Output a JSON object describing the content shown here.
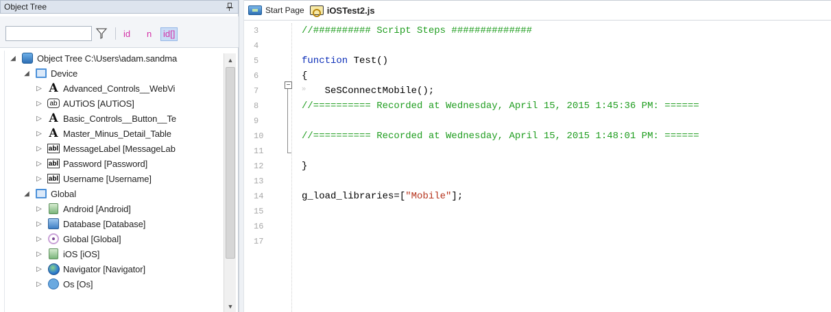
{
  "object_tree": {
    "title": "Object Tree",
    "filter": {
      "value": "",
      "placeholder": ""
    },
    "modes": {
      "id": "id",
      "n": "n",
      "idx_open": "id[",
      "idx_close": "]"
    },
    "nodes": [
      {
        "label": "Object Tree C:\\Users\\adam.sandma",
        "icon": "database-tree-icon",
        "expanded": true
      },
      {
        "label": "Device",
        "icon": "device-box-icon",
        "expanded": true
      },
      {
        "label": "Advanced_Controls__WebVi",
        "icon": "text-control-icon",
        "expanded": false
      },
      {
        "label": "AUTiOS [AUTiOS]",
        "icon": "ab-control-icon",
        "expanded": false
      },
      {
        "label": "Basic_Controls__Button__Te",
        "icon": "text-control-icon",
        "expanded": false
      },
      {
        "label": "Master_Minus_Detail_Table",
        "icon": "text-control-icon",
        "expanded": false
      },
      {
        "label": "MessageLabel [MessageLab",
        "icon": "label-control-icon",
        "expanded": false
      },
      {
        "label": "Password [Password]",
        "icon": "label-control-icon",
        "expanded": false
      },
      {
        "label": "Username [Username]",
        "icon": "label-control-icon",
        "expanded": false
      },
      {
        "label": "Global",
        "icon": "global-box-icon",
        "expanded": true
      },
      {
        "label": "Android [Android]",
        "icon": "android-icon",
        "expanded": false
      },
      {
        "label": "Database [Database]",
        "icon": "database-icon",
        "expanded": false
      },
      {
        "label": "Global [Global]",
        "icon": "global-icon",
        "expanded": false
      },
      {
        "label": "iOS [iOS]",
        "icon": "ios-icon",
        "expanded": false
      },
      {
        "label": "Navigator [Navigator]",
        "icon": "navigator-icon",
        "expanded": false
      },
      {
        "label": "Os [Os]",
        "icon": "os-icon",
        "expanded": false
      }
    ]
  },
  "editor": {
    "tabs": [
      {
        "label": "Start Page",
        "icon": "start-page-icon",
        "active": false
      },
      {
        "label": "iOSTest2.js",
        "icon": "script-file-icon",
        "active": true
      }
    ],
    "lines": [
      {
        "number": "3",
        "parts": [
          {
            "t": "//########## Script Steps ##############",
            "k": "comment"
          }
        ]
      },
      {
        "number": "4",
        "parts": []
      },
      {
        "number": "5",
        "parts": [
          {
            "t": "function",
            "k": "keyword"
          },
          {
            "t": " Test()",
            "k": "def"
          }
        ]
      },
      {
        "number": "6",
        "parts": [
          {
            "t": "{",
            "k": "op"
          }
        ]
      },
      {
        "number": "7",
        "parts": [
          {
            "t": "    SeSConnectMobile();",
            "k": "def"
          }
        ]
      },
      {
        "number": "8",
        "parts": [
          {
            "t": "//========== Recorded at Wednesday, April 15, 2015 1:45:36 PM: ======",
            "k": "comment"
          }
        ]
      },
      {
        "number": "9",
        "parts": []
      },
      {
        "number": "10",
        "parts": [
          {
            "t": "//========== Recorded at Wednesday, April 15, 2015 1:48:01 PM: ======",
            "k": "comment"
          }
        ]
      },
      {
        "number": "11",
        "parts": []
      },
      {
        "number": "12",
        "parts": [
          {
            "t": "}",
            "k": "op"
          }
        ]
      },
      {
        "number": "13",
        "parts": []
      },
      {
        "number": "14",
        "parts": [
          {
            "t": "g_load_libraries=[",
            "k": "def"
          },
          {
            "t": "\"Mobile\"",
            "k": "string"
          },
          {
            "t": "];",
            "k": "op"
          }
        ]
      },
      {
        "number": "15",
        "parts": []
      },
      {
        "number": "16",
        "parts": []
      },
      {
        "number": "17",
        "parts": []
      }
    ],
    "fold_marker": "−",
    "whitespace_marker": "»"
  },
  "colors": {
    "comment": "#1f9d1f",
    "keyword": "#0b2eb8",
    "string": "#b5321b",
    "mode_accent": "#d42fa7"
  }
}
